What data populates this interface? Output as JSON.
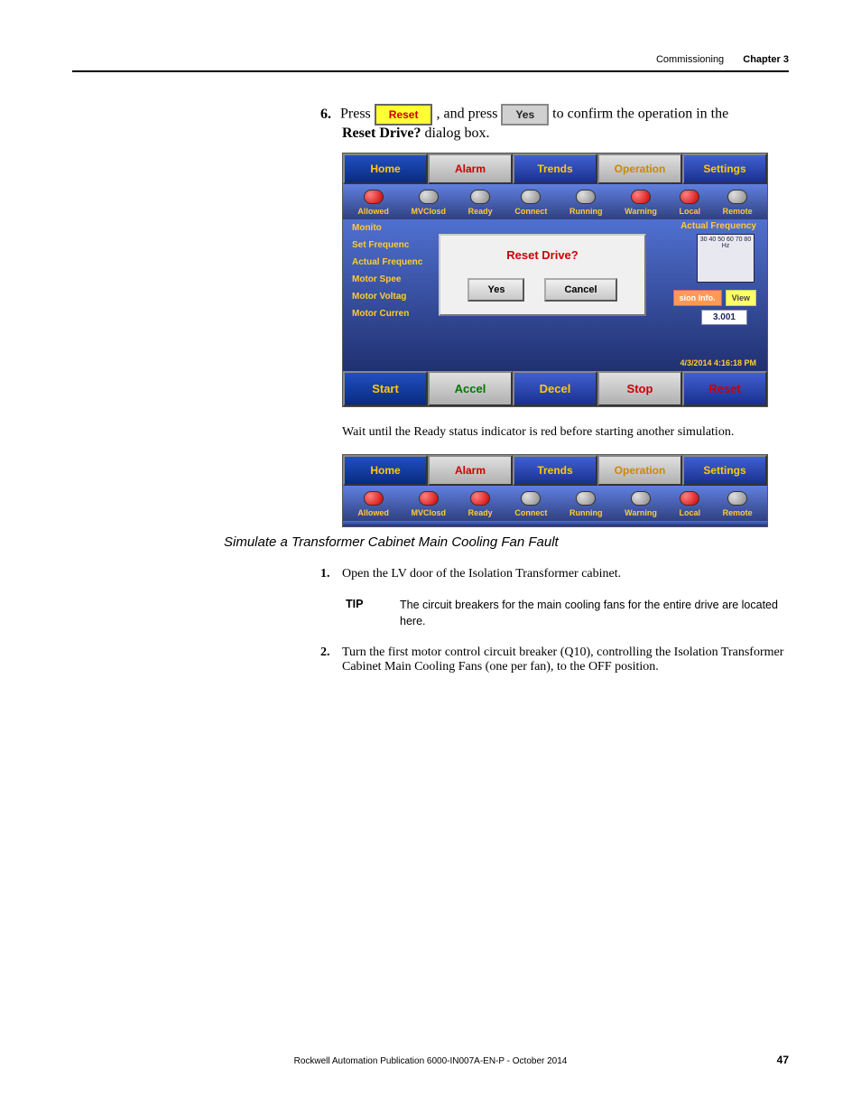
{
  "header": {
    "title": "Commissioning",
    "chapter": "Chapter 3"
  },
  "step6": {
    "num": "6.",
    "pre": "Press",
    "reset_btn": "Reset",
    "mid": ", and press",
    "yes_btn": "Yes",
    "post": "to confirm the operation in the",
    "dialog_name": "Reset Drive?",
    "post2": "dialog box."
  },
  "hmi": {
    "tabs": {
      "home": "Home",
      "alarm": "Alarm",
      "trends": "Trends",
      "operation": "Operation",
      "settings": "Settings"
    },
    "status": [
      "Allowed",
      "MVClosd",
      "Ready",
      "Connect",
      "Running",
      "Warning",
      "Local",
      "Remote"
    ],
    "side": [
      "Monito",
      "Set Frequenc",
      "Actual Frequenc",
      "Motor Spee",
      "Motor Voltag",
      "Motor Curren"
    ],
    "modal": {
      "title": "Reset Drive?",
      "yes": "Yes",
      "cancel": "Cancel"
    },
    "freq_label": "Actual Frequency",
    "gauge_ticks": "30   40   50   60   70   80 Hz",
    "info_btn": "sion Info.",
    "view_btn": "View",
    "freq_val": "3.001",
    "timestamp": "4/3/2014 4:16:18 PM",
    "bottom": {
      "start": "Start",
      "accel": "Accel",
      "decel": "Decel",
      "stop": "Stop",
      "reset": "Reset"
    }
  },
  "wait_text": "Wait until the Ready status indicator is red before starting another simulation.",
  "hmi2_status_states": [
    "red",
    "red",
    "red",
    "grey",
    "grey",
    "grey",
    "red",
    "grey"
  ],
  "section_heading": "Simulate a Transformer Cabinet Main Cooling Fan Fault",
  "steps": {
    "s1": {
      "num": "1.",
      "text": "Open the LV door of the Isolation Transformer cabinet."
    },
    "tip": {
      "tag": "TIP",
      "text": "The circuit breakers for the main cooling fans for the entire drive are located here."
    },
    "s2": {
      "num": "2.",
      "text": "Turn the first motor control circuit breaker (Q10), controlling the Isolation Transformer Cabinet Main Cooling Fans (one per fan), to the OFF position."
    }
  },
  "footer": {
    "pub": "Rockwell Automation Publication 6000-IN007A-EN-P - October 2014",
    "page": "47"
  },
  "chart_data": {
    "type": "gauge",
    "title": "Actual Frequency",
    "unit": "Hz",
    "ticks": [
      30,
      40,
      50,
      60,
      70,
      80
    ],
    "value": 3.001
  }
}
